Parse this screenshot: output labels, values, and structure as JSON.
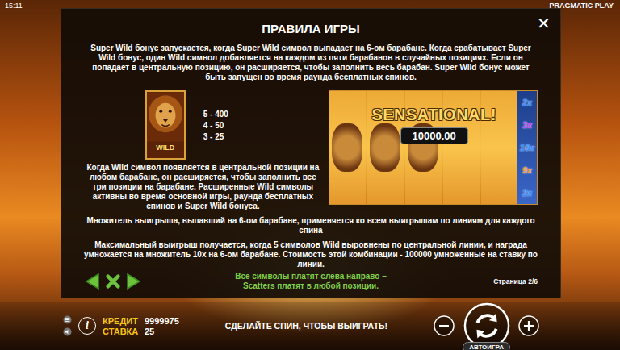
{
  "status": {
    "time": "15:11",
    "provider": "PRAGMATIC PLAY"
  },
  "dialog": {
    "title": "ПРАВИЛА ИГРЫ",
    "close": "✕",
    "intro": "Super Wild бонус запускается, когда Super Wild символ выпадает на 6-ом барабане. Когда срабатывает Super Wild бонус, один Wild символ добавляется на каждом из пяти барабанов в случайных позициях. Если он попадает в центральную позицию, он расширяется, чтобы заполнить весь барабан. Super Wild бонус может быть запущен во время раунда бесплатных спинов.",
    "wild": {
      "label": "WILD",
      "pays": [
        "5 - 400",
        "4 - 50",
        "3 - 25"
      ]
    },
    "wild_text": "Когда Wild символ появляется в центральной позиции на любом барабане, он расширяется, чтобы заполнить все три позиции на барабане. Расширенные Wild символы активны во время основной игры, раунда бесплатных спинов и Super Wild бонуса.",
    "preview": {
      "banner": "SENSATIONAL!",
      "amount": "10000.00",
      "multipliers": [
        {
          "text": "2x",
          "color": "#2f8cff"
        },
        {
          "text": "3x",
          "color": "#d23cff"
        },
        {
          "text": "10x",
          "color": "#2f8cff"
        },
        {
          "text": "9x",
          "color": "#ff9a1a"
        },
        {
          "text": "2x",
          "color": "#2f8cff"
        }
      ]
    },
    "multiplier_text": "Множитель выигрыша, выпавший на 6-ом барабане, применяется ко всем выигрышам по линиям для каждого спина",
    "max_win_text": "Максимальный выигрыш получается, когда 5 символов Wild выровнены по центральной линии, и награда умножается на множитель 10x на 6-ом барабане. Стоимость этой комбинации - 100000 умноженные на ставку по линии.",
    "note": [
      "Все символы платят слева направо –",
      "Scatters платят в любой позиции."
    ],
    "page": "Страница 2/6"
  },
  "bottom_bar": {
    "info": "i",
    "credit": {
      "label": "КРЕДИТ",
      "value": "9999975"
    },
    "bet": {
      "label": "СТАВКА",
      "value": "25"
    },
    "message": "СДЕЛАЙТЕ СПИН, ЧТОБЫ ВЫИГРАТЬ!",
    "autoplay": "АВТОИГРА"
  }
}
